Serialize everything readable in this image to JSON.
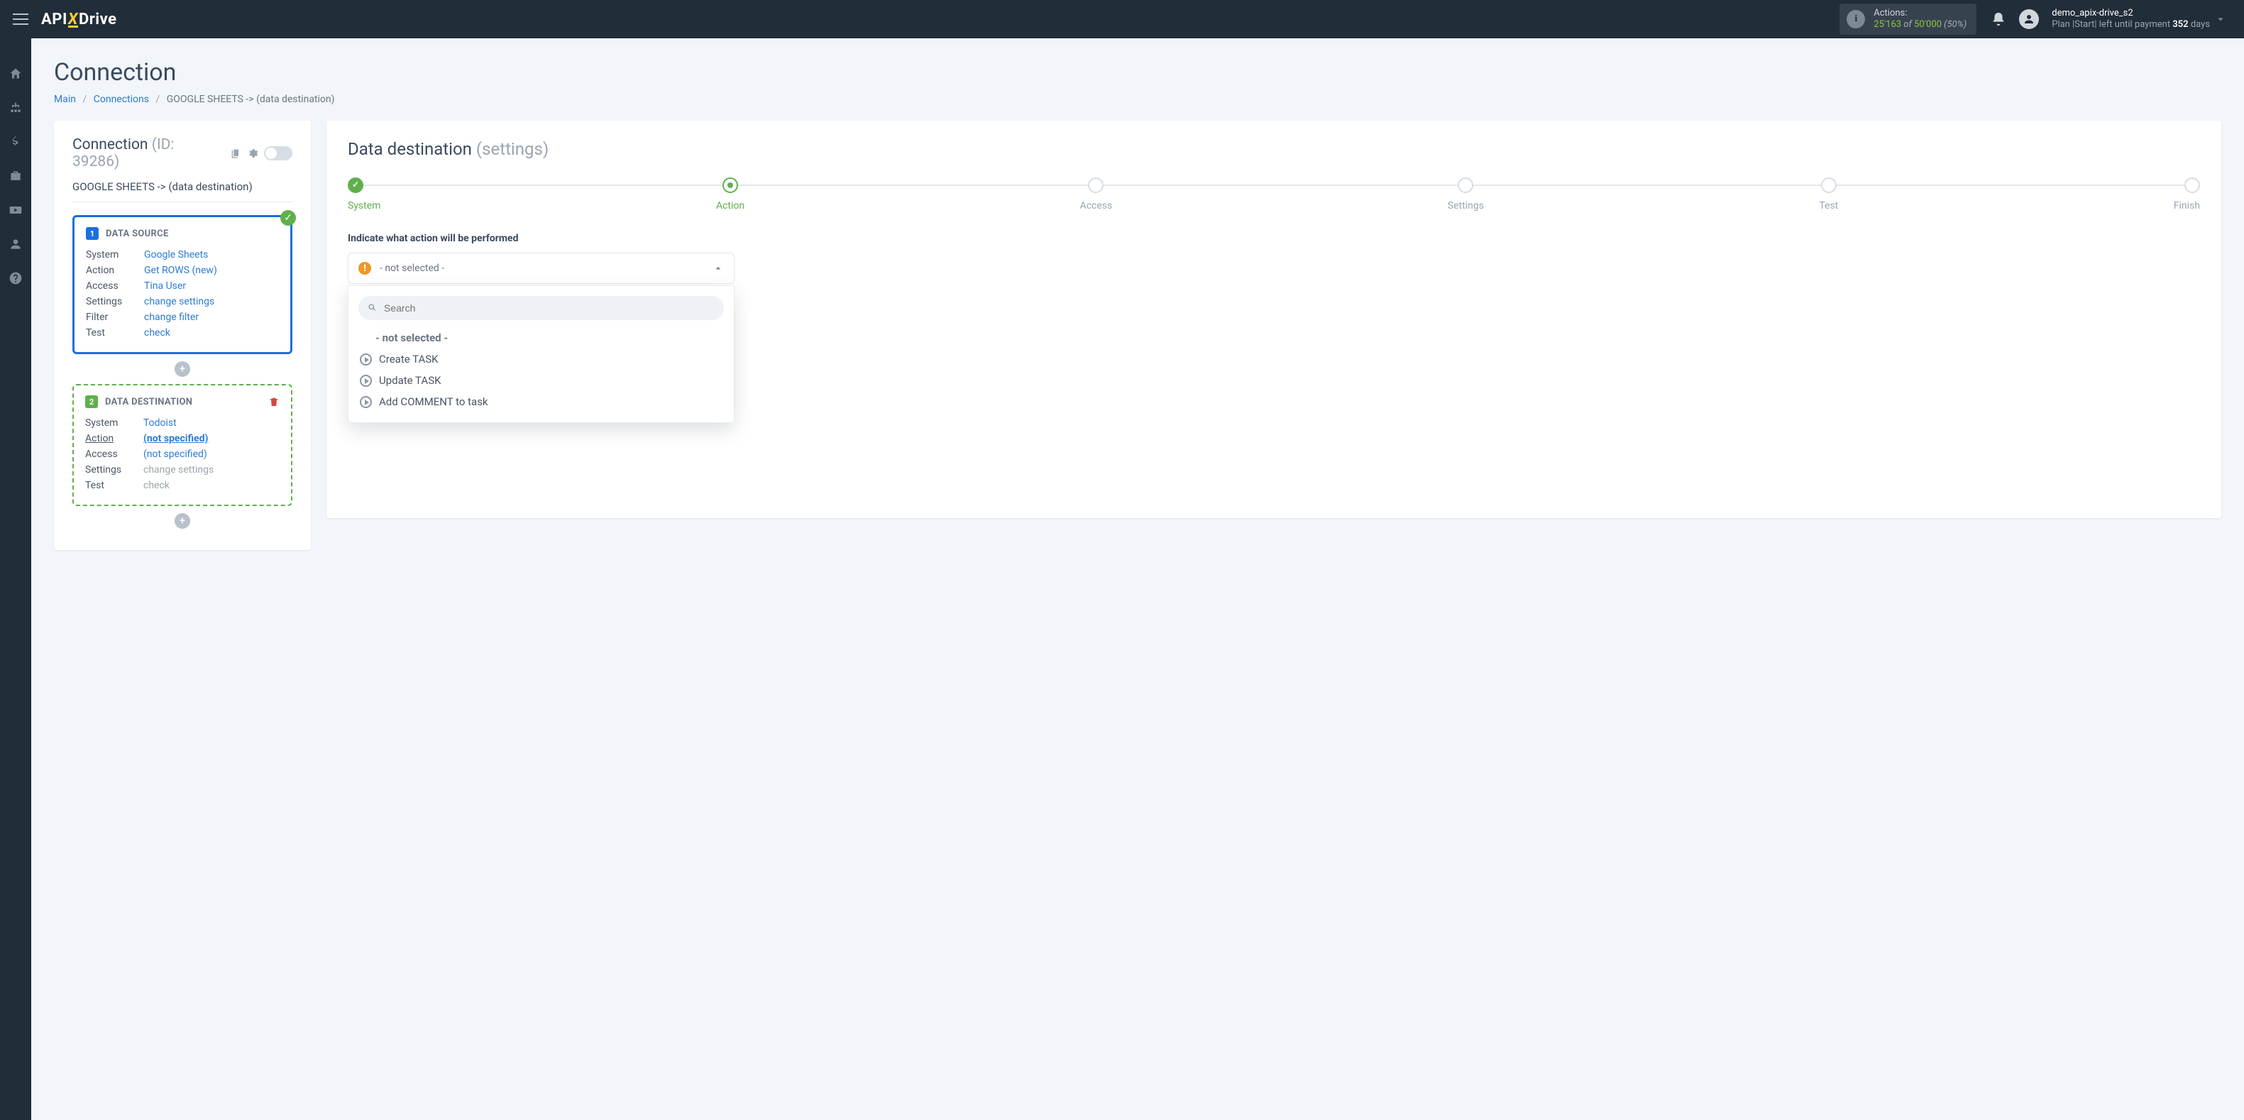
{
  "header": {
    "actions": {
      "label": "Actions:",
      "used": "25'163",
      "of": "of",
      "total": "50'000",
      "pct": "(50%)"
    },
    "user": {
      "name": "demo_apix-drive_s2",
      "plan_prefix": "Plan |Start| left until payment ",
      "days": "352",
      "days_suffix": " days"
    }
  },
  "page": {
    "title": "Connection",
    "breadcrumb": {
      "main": "Main",
      "connections": "Connections",
      "current": "GOOGLE SHEETS -> (data destination)"
    }
  },
  "left": {
    "title": "Connection",
    "id": "(ID: 39286)",
    "name": "GOOGLE SHEETS -> (data destination)",
    "src": {
      "badge": "1",
      "title": "DATA SOURCE",
      "rows": [
        {
          "k": "System",
          "v": "Google Sheets"
        },
        {
          "k": "Action",
          "v": "Get ROWS (new)"
        },
        {
          "k": "Access",
          "v": "Tina User"
        },
        {
          "k": "Settings",
          "v": "change settings"
        },
        {
          "k": "Filter",
          "v": "change filter"
        },
        {
          "k": "Test",
          "v": "check"
        }
      ]
    },
    "dst": {
      "badge": "2",
      "title": "DATA DESTINATION",
      "rows": [
        {
          "k": "System",
          "v": "Todoist",
          "cls": ""
        },
        {
          "k": "Action",
          "v": "(not specified)",
          "cls": "bold",
          "ku": "u"
        },
        {
          "k": "Access",
          "v": "(not specified)",
          "cls": ""
        },
        {
          "k": "Settings",
          "v": "change settings",
          "cls": "muted"
        },
        {
          "k": "Test",
          "v": "check",
          "cls": "muted"
        }
      ]
    }
  },
  "right": {
    "title": "Data destination",
    "subtitle": "(settings)",
    "steps": [
      "System",
      "Action",
      "Access",
      "Settings",
      "Test",
      "Finish"
    ],
    "form_label": "Indicate what action will be performed",
    "selected": "- not selected -",
    "search_ph": "Search",
    "options": [
      "- not selected -",
      "Create TASK",
      "Update TASK",
      "Add COMMENT to task"
    ]
  }
}
